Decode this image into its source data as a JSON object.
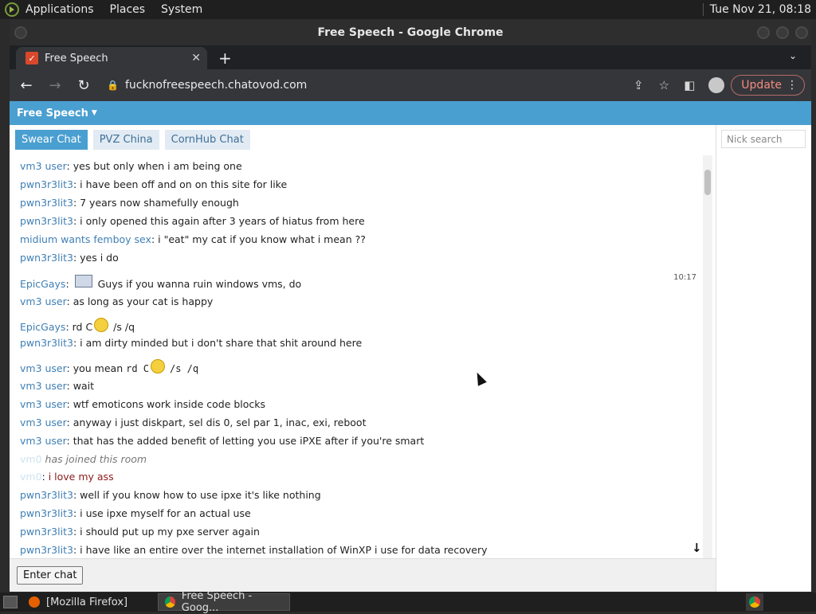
{
  "system_bar": {
    "menus": [
      "Applications",
      "Places",
      "System"
    ],
    "clock": "Tue Nov 21, 08:18"
  },
  "window": {
    "title": "Free Speech - Google Chrome"
  },
  "browser": {
    "tab_title": "Free Speech",
    "url": "fucknofreespeech.chatovod.com",
    "update_label": "Update"
  },
  "site": {
    "room_menu": "Free Speech",
    "rooms": [
      {
        "label": "Swear Chat",
        "active": true
      },
      {
        "label": "PVZ China",
        "active": false
      },
      {
        "label": "CornHub Chat",
        "active": false
      }
    ],
    "timestamp": "10:17",
    "enter_chat": "Enter chat",
    "nick_search_placeholder": "Nick search"
  },
  "messages": [
    {
      "nick": "vm3 user",
      "text": "yes but only when i am being one"
    },
    {
      "nick": "pwn3r3lit3",
      "text": "i have been off and on on this site for like"
    },
    {
      "nick": "pwn3r3lit3",
      "text": "7 years now shamefully enough"
    },
    {
      "nick": "pwn3r3lit3",
      "text": "i only opened this again after 3 years of hiatus from here"
    },
    {
      "nick": "midium wants femboy sex",
      "text": "i \"eat\" my cat if you know what i mean ??"
    },
    {
      "nick": "pwn3r3lit3",
      "text": "yes i do"
    },
    {
      "nick": "EpicGays",
      "text": "Guys if you wanna ruin windows vms, do"
    },
    {
      "nick": "vm3 user",
      "text": "as long as your cat is happy"
    },
    {
      "nick": "EpicGays",
      "text_a": "rd C",
      "text_b": "/s /q"
    },
    {
      "nick": "pwn3r3lit3",
      "text": "i am dirty minded but i don't share that shit around here"
    },
    {
      "nick": "vm3 user",
      "text_a": "you mean",
      "code_a": "rd C",
      "code_b": "/s /q"
    },
    {
      "nick": "vm3 user",
      "text": "wait"
    },
    {
      "nick": "vm3 user",
      "text": "wtf emoticons work inside code blocks"
    },
    {
      "nick": "vm3 user",
      "text": "anyway i just diskpart, sel dis 0, sel par 1, inac, exi, reboot"
    },
    {
      "nick": "vm3 user",
      "text": "that has the added benefit of letting you use iPXE after if you're smart"
    },
    {
      "nick": "vm0",
      "text": "has joined this room"
    },
    {
      "nick": "vm0",
      "text": "i love my ass"
    },
    {
      "nick": "pwn3r3lit3",
      "text": "well if you know how to use ipxe it's like nothing"
    },
    {
      "nick": "pwn3r3lit3",
      "text": "i use ipxe myself for an actual use"
    },
    {
      "nick": "pwn3r3lit3",
      "text": "i should put up my pxe server again"
    },
    {
      "nick": "pwn3r3lit3",
      "text": "i have like an entire over the internet installation of WinXP i use for data recovery"
    }
  ],
  "taskbar": {
    "items": [
      "[Mozilla Firefox]",
      "Free Speech - Goog..."
    ]
  }
}
